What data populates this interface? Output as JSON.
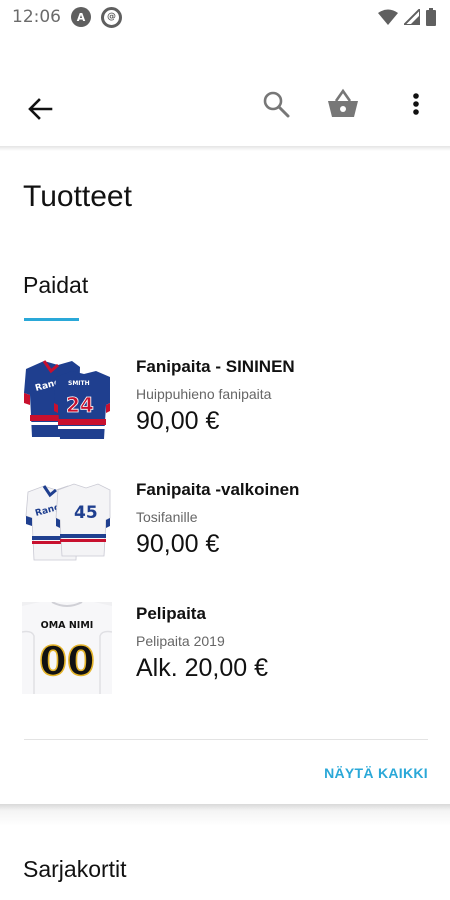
{
  "status_bar": {
    "time": "12:06",
    "icons": [
      "notification-a-icon",
      "sync-icon",
      "wifi-icon",
      "signal-icon",
      "battery-icon"
    ]
  },
  "app_bar": {
    "icons": [
      "back-arrow-icon",
      "search-icon",
      "basket-icon",
      "more-vert-icon"
    ]
  },
  "page": {
    "title": "Tuotteet"
  },
  "sections": [
    {
      "title": "Paidat",
      "products": [
        {
          "name": "Fanipaita - SININEN",
          "description": "Huippuhieno fanipaita",
          "price": "90,00 €"
        },
        {
          "name": "Fanipaita -valkoinen",
          "description": "Tosifanille",
          "price": "90,00 €"
        },
        {
          "name": "Pelipaita",
          "description": "Pelipaita 2019",
          "price": "Alk. 20,00 €",
          "jersey_text": "OMA NIMI",
          "jersey_number": "00"
        }
      ],
      "jersey_numbers": [
        "24",
        "45"
      ],
      "show_all_label": "NÄYTÄ KAIKKI"
    },
    {
      "title": "Sarjakortit"
    }
  ],
  "colors": {
    "accent": "#2aa8d8",
    "jersey_blue": "#1f3f8f",
    "jersey_red": "#c8102e"
  }
}
